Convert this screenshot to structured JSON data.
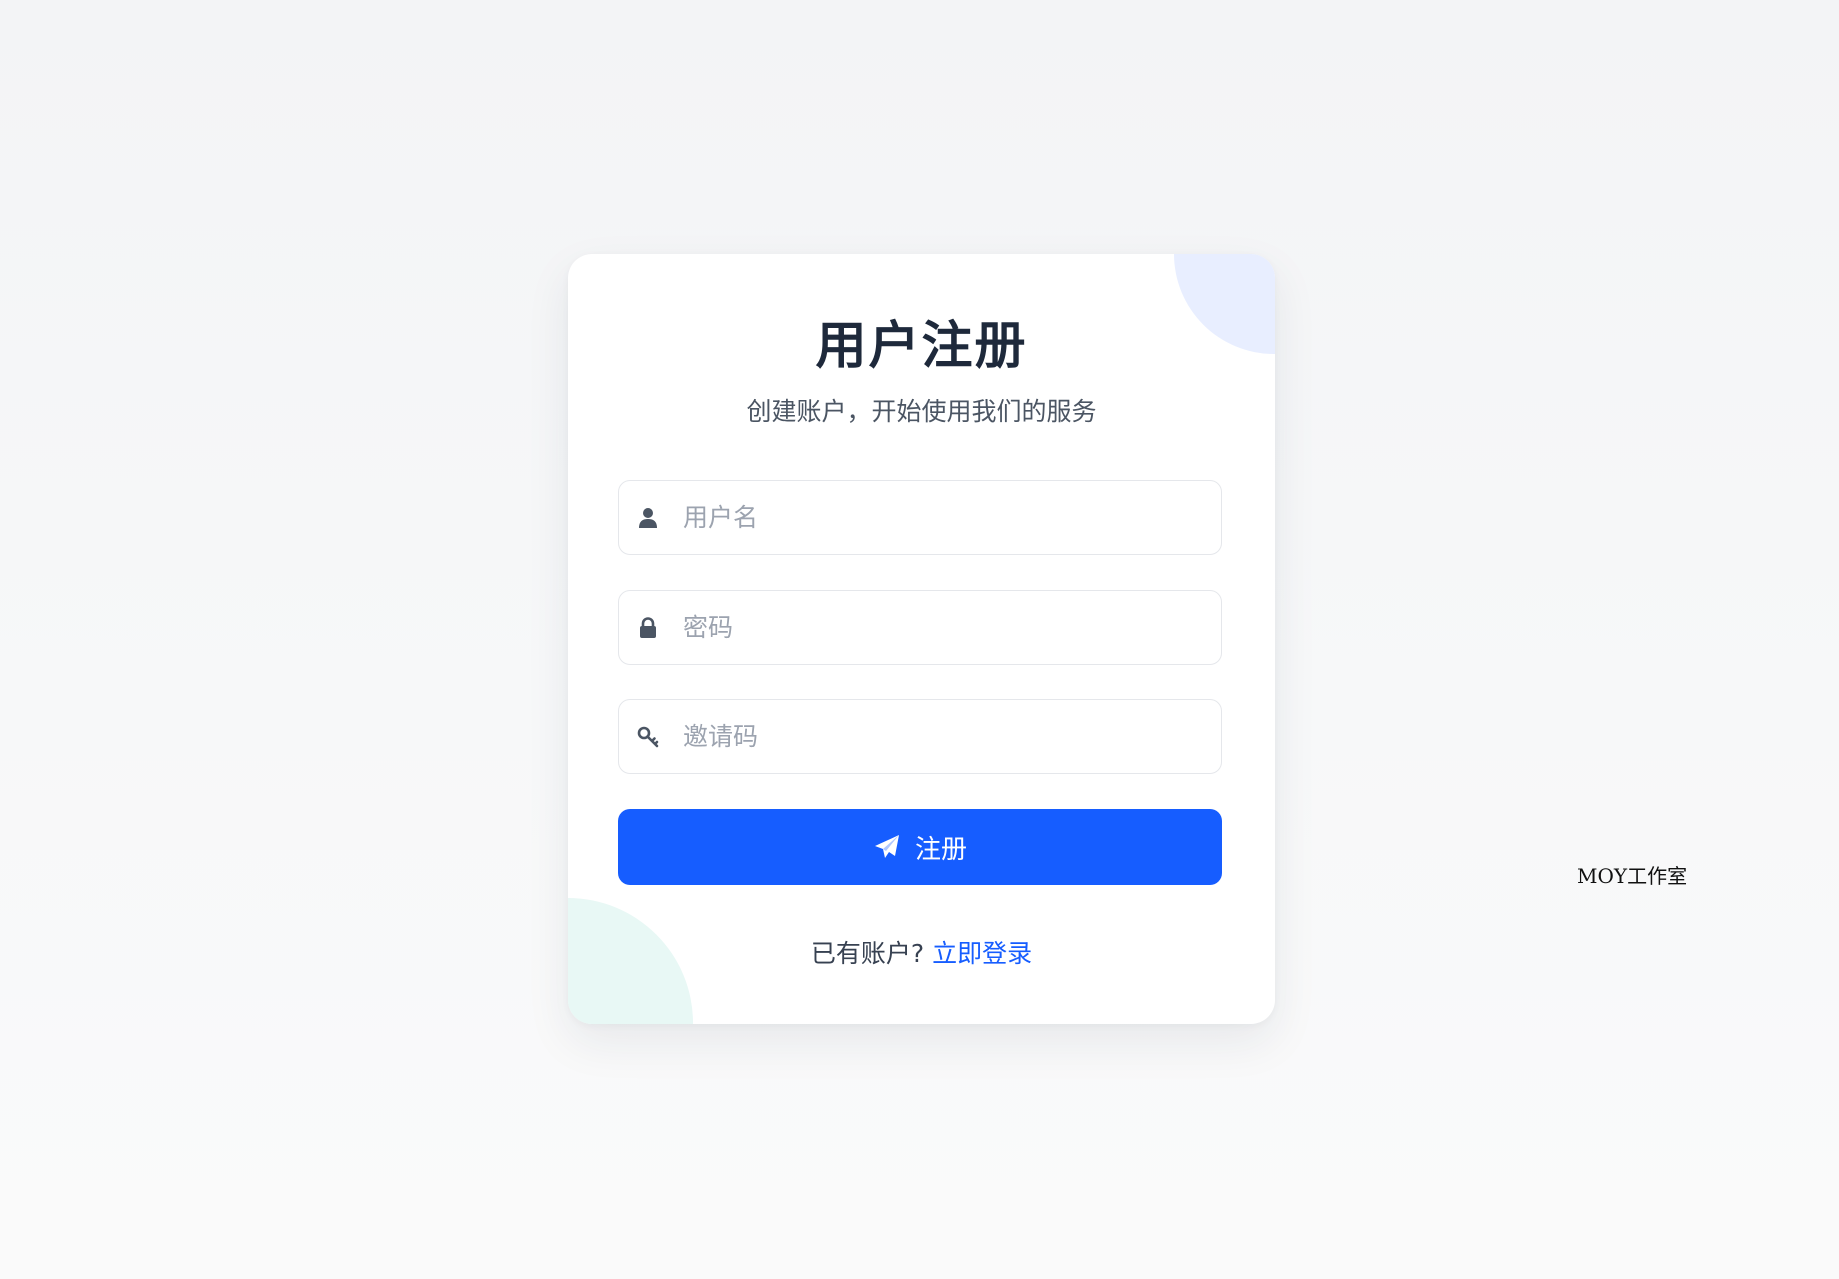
{
  "page": {
    "title": "用户注册",
    "subtitle": "创建账户，开始使用我们的服务"
  },
  "form": {
    "username": {
      "placeholder": "用户名",
      "value": "",
      "icon": "user-icon"
    },
    "password": {
      "placeholder": "密码",
      "value": "",
      "icon": "lock-icon"
    },
    "invite_code": {
      "placeholder": "邀请码",
      "value": "",
      "icon": "key-icon"
    },
    "submit_label": "注册",
    "submit_icon": "paper-plane-icon"
  },
  "footer": {
    "prompt": "已有账户? ",
    "login_link": "立即登录"
  },
  "watermark": "MOY工作室",
  "colors": {
    "primary": "#165dff",
    "title": "#1e293b",
    "deco_top": "#e8eeff",
    "deco_bottom": "#e8f8f5"
  }
}
